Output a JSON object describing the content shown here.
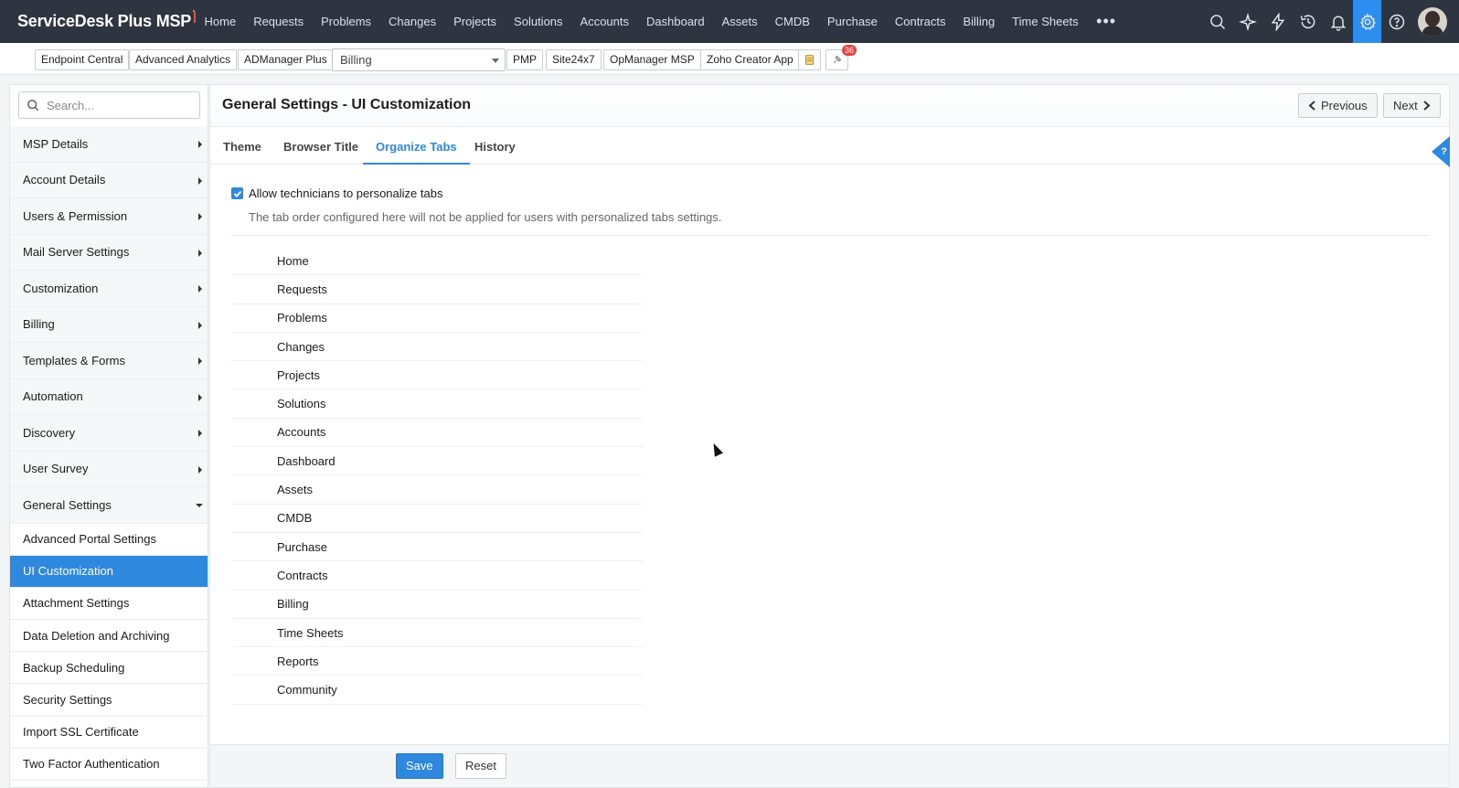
{
  "app": {
    "logo_text": "ServiceDesk Plus MSP"
  },
  "topnav": {
    "items": [
      "Home",
      "Requests",
      "Problems",
      "Changes",
      "Projects",
      "Solutions",
      "Accounts",
      "Dashboard",
      "Assets",
      "CMDB",
      "Purchase",
      "Contracts",
      "Billing",
      "Time Sheets"
    ],
    "more_label": "•••",
    "icons": [
      "search-icon",
      "sparkle-icon",
      "lightning-icon",
      "history-icon",
      "bell-icon",
      "gear-icon",
      "help-icon"
    ],
    "active_icon": "gear-icon"
  },
  "toolbar2": {
    "buttons": [
      "Endpoint Central",
      "Advanced Analytics",
      "ADManager Plus"
    ],
    "select_value": "Billing",
    "buttons_after": [
      "PMP",
      "Site24x7",
      "OpManager MSP",
      "Zoho Creator App"
    ],
    "badge_count": "36"
  },
  "sidebar": {
    "search_placeholder": "Search...",
    "items": [
      "MSP Details",
      "Account Details",
      "Users & Permission",
      "Mail Server Settings",
      "Customization",
      "Billing",
      "Templates & Forms",
      "Automation",
      "Discovery",
      "User Survey"
    ],
    "expanded_item": "General Settings",
    "sub_items": [
      "Advanced Portal Settings",
      "UI Customization",
      "Attachment Settings",
      "Data Deletion and Archiving",
      "Backup Scheduling",
      "Security Settings",
      "Import SSL Certificate",
      "Two Factor Authentication"
    ],
    "selected_sub_item": "UI Customization"
  },
  "main": {
    "title": "General Settings - UI Customization",
    "prev_label": "Previous",
    "next_label": "Next",
    "tabs": [
      "Theme",
      "Browser Title",
      "Organize Tabs",
      "History"
    ],
    "active_tab": "Organize Tabs",
    "help_label": "?",
    "checkbox_label": "Allow technicians to personalize tabs",
    "checkbox_checked": true,
    "hint": "The tab order configured here will not be applied for users with personalized tabs settings.",
    "tab_order": [
      "Home",
      "Requests",
      "Problems",
      "Changes",
      "Projects",
      "Solutions",
      "Accounts",
      "Dashboard",
      "Assets",
      "CMDB",
      "Purchase",
      "Contracts",
      "Billing",
      "Time Sheets",
      "Reports",
      "Community"
    ],
    "save_label": "Save",
    "reset_label": "Reset"
  },
  "colors": {
    "topnav_bg": "#2f3441",
    "accent": "#2d88de"
  }
}
